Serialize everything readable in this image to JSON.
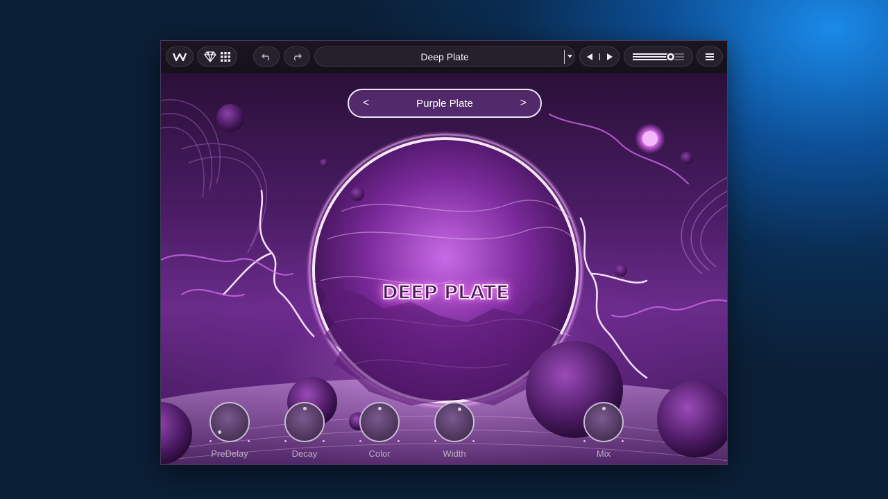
{
  "toolbar": {
    "logo_icon": "waves-logo-icon",
    "preset_browser_icons": [
      "diamond-icon",
      "grid-icon"
    ],
    "undo_icon": "undo-icon",
    "redo_icon": "redo-icon",
    "preset_name": "Deep Plate",
    "preset_dropdown_icon": "caret-down-icon",
    "prev_icon": "triangle-left-icon",
    "next_icon": "triangle-right-icon",
    "output_level": 0.74,
    "menu_icon": "hamburger-icon"
  },
  "preset_nav": {
    "label": "Purple Plate",
    "prev": "<",
    "next": ">"
  },
  "artwork": {
    "title": "DEEP PLATE"
  },
  "knobs": [
    {
      "label": "PreDelay",
      "value": 0.0
    },
    {
      "label": "Decay",
      "value": 0.5
    },
    {
      "label": "Color",
      "value": 0.5
    },
    {
      "label": "Width",
      "value": 0.58
    },
    {
      "label": "Mix",
      "value": 0.5
    }
  ],
  "colors": {
    "accent": "#b64ee0",
    "glow": "#f3d6ff",
    "background": "#0b1f36"
  }
}
